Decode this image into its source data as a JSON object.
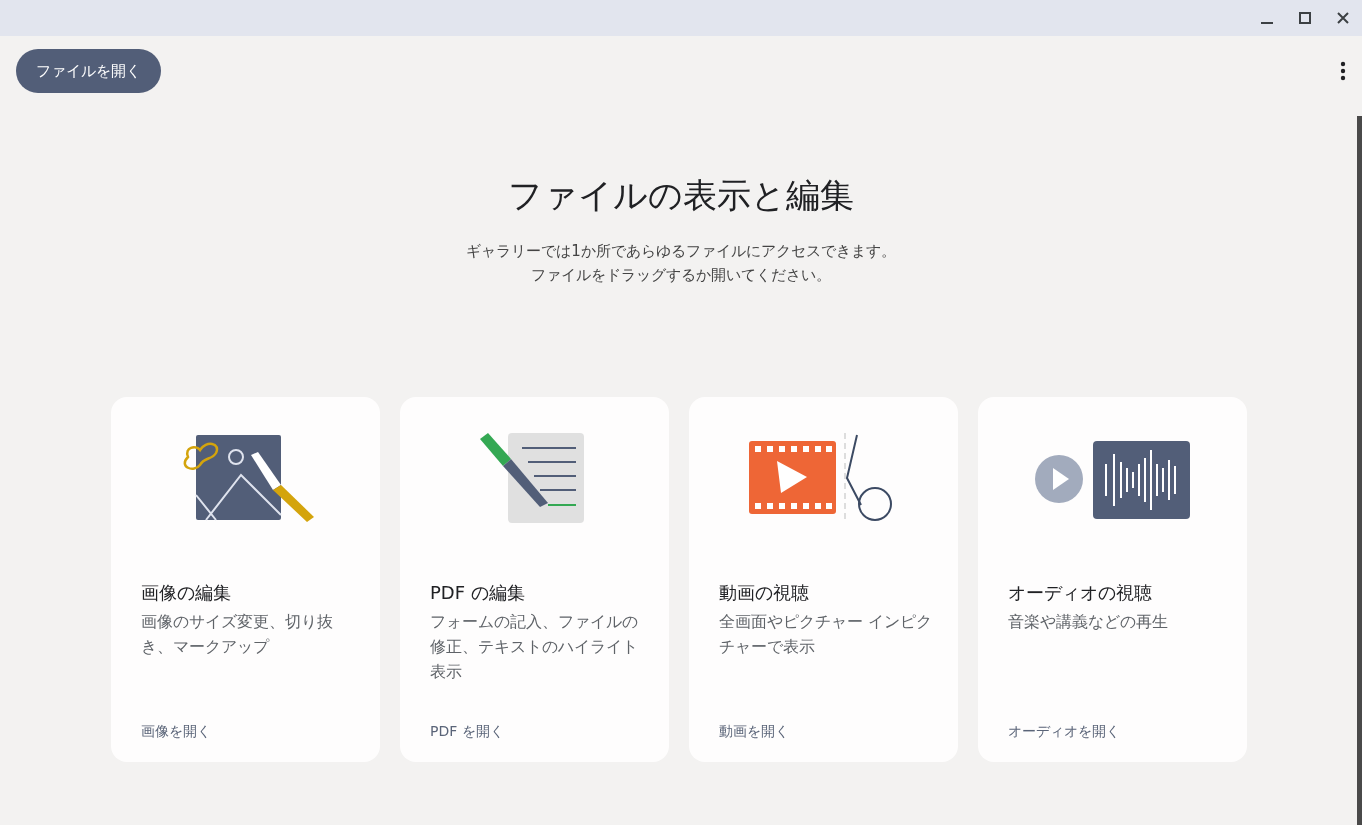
{
  "toolbar": {
    "open_button": "ファイルを開く"
  },
  "hero": {
    "title": "ファイルの表示と編集",
    "lines": [
      "ギャラリーでは1か所であらゆるファイルにアクセスできます。",
      "ファイルをドラッグするか開いてください。"
    ]
  },
  "cards": [
    {
      "kind": "image",
      "title": "画像の編集",
      "description": "画像のサイズ変更、切り抜き、マークアップ",
      "link": "画像を開く"
    },
    {
      "kind": "pdf",
      "title": "PDF の編集",
      "description": "フォームの記入、ファイルの修正、テキストのハイライト表示",
      "link": "PDF を開く"
    },
    {
      "kind": "video",
      "title": "動画の視聴",
      "description": "全画面やピクチャー インピクチャーで表示",
      "link": "動画を開く"
    },
    {
      "kind": "audio",
      "title": "オーディオの視聴",
      "description": "音楽や講義などの再生",
      "link": "オーディオを開く"
    }
  ]
}
